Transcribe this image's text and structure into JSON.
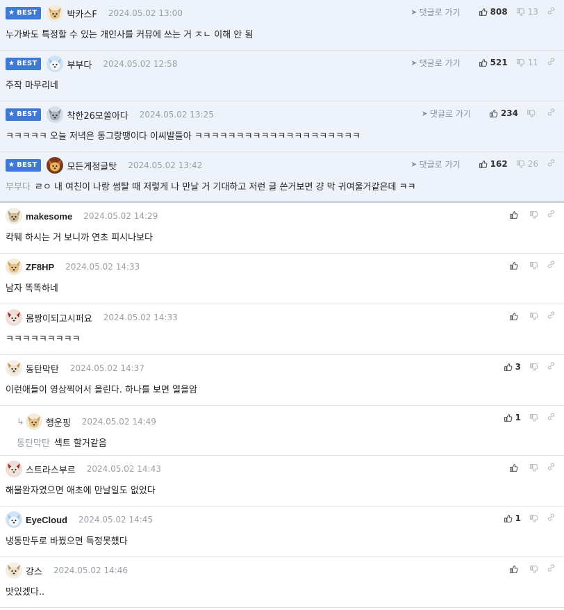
{
  "labels": {
    "best": "BEST",
    "goto": "댓글로 가기"
  },
  "best_comments": [
    {
      "nick": "박카스F",
      "avatar": "fennec",
      "date": "2024.05.02 13:00",
      "text": "누가봐도 특정할 수 있는 개인사를 커뮤에 쓰는 거 ㅈㄴ 이해 안 됨",
      "up": "808",
      "down": "13"
    },
    {
      "nick": "부부다",
      "avatar": "polar",
      "date": "2024.05.02 12:58",
      "text": "주작 마무리네",
      "up": "521",
      "down": "11"
    },
    {
      "nick": "착한26모쏠아다",
      "avatar": "koala",
      "date": "2024.05.02 13:25",
      "text": "ㅋㅋㅋㅋㅋ 오늘 저녁은 동그랑땡이다 이씨발들아 ㅋㅋㅋㅋㅋㅋㅋㅋㅋㅋㅋㅋㅋㅋㅋㅋㅋㅋㅋㅋ",
      "up": "234",
      "down": ""
    },
    {
      "nick": "모든게정글탓",
      "avatar": "lion",
      "date": "2024.05.02 13:42",
      "mention": "부부다",
      "text": "ㄹㅇ 내 여친이 나랑 썸탈 때 저렇게 나 만날 거 기대하고 저런 글 쓴거보면 걍 막 귀여울거같은데 ㅋㅋ",
      "up": "162",
      "down": "26"
    }
  ],
  "comments": [
    {
      "nick": "makesome",
      "avatar": "beige",
      "date": "2024.05.02 14:29",
      "text": "칵퉤 하시는 거 보니까 연초 피시나보다",
      "up": "",
      "reply": false
    },
    {
      "nick": "ZF8HP",
      "avatar": "fennec",
      "date": "2024.05.02 14:33",
      "text": "남자 똑똑하네",
      "up": "",
      "reply": false
    },
    {
      "nick": "몸짱이되고시퍼요",
      "avatar": "red",
      "date": "2024.05.02 14:33",
      "text": "ㅋㅋㅋㅋㅋㅋㅋㅋㅋ",
      "up": "",
      "reply": false
    },
    {
      "nick": "동탄막탄",
      "avatar": "pup",
      "date": "2024.05.02 14:37",
      "text": "이런애들이 영상찍어서 올린다. 하나를 보면 열을암",
      "up": "3",
      "reply": false
    },
    {
      "nick": "행운핑",
      "avatar": "fennec",
      "date": "2024.05.02 14:49",
      "mention": "동탄막탄",
      "text": "섹트 할거같음",
      "up": "1",
      "reply": true
    },
    {
      "nick": "스트라스부르",
      "avatar": "red",
      "date": "2024.05.02 14:43",
      "text": "해물완자였으면 애초에 만날일도 없었다",
      "up": "",
      "reply": false
    },
    {
      "nick": "EyeCloud",
      "avatar": "polar",
      "date": "2024.05.02 14:45",
      "text": "냉동만두로 바꿨으면 특정못했다",
      "up": "1",
      "reply": false
    },
    {
      "nick": "강스",
      "avatar": "pup",
      "date": "2024.05.02 14:46",
      "text": "맛있겠다..",
      "up": "",
      "reply": false
    }
  ],
  "colors": {
    "best_badge": "#3f79d6",
    "best_bg": "#eef3fb",
    "meta": "#9aa0a6"
  }
}
